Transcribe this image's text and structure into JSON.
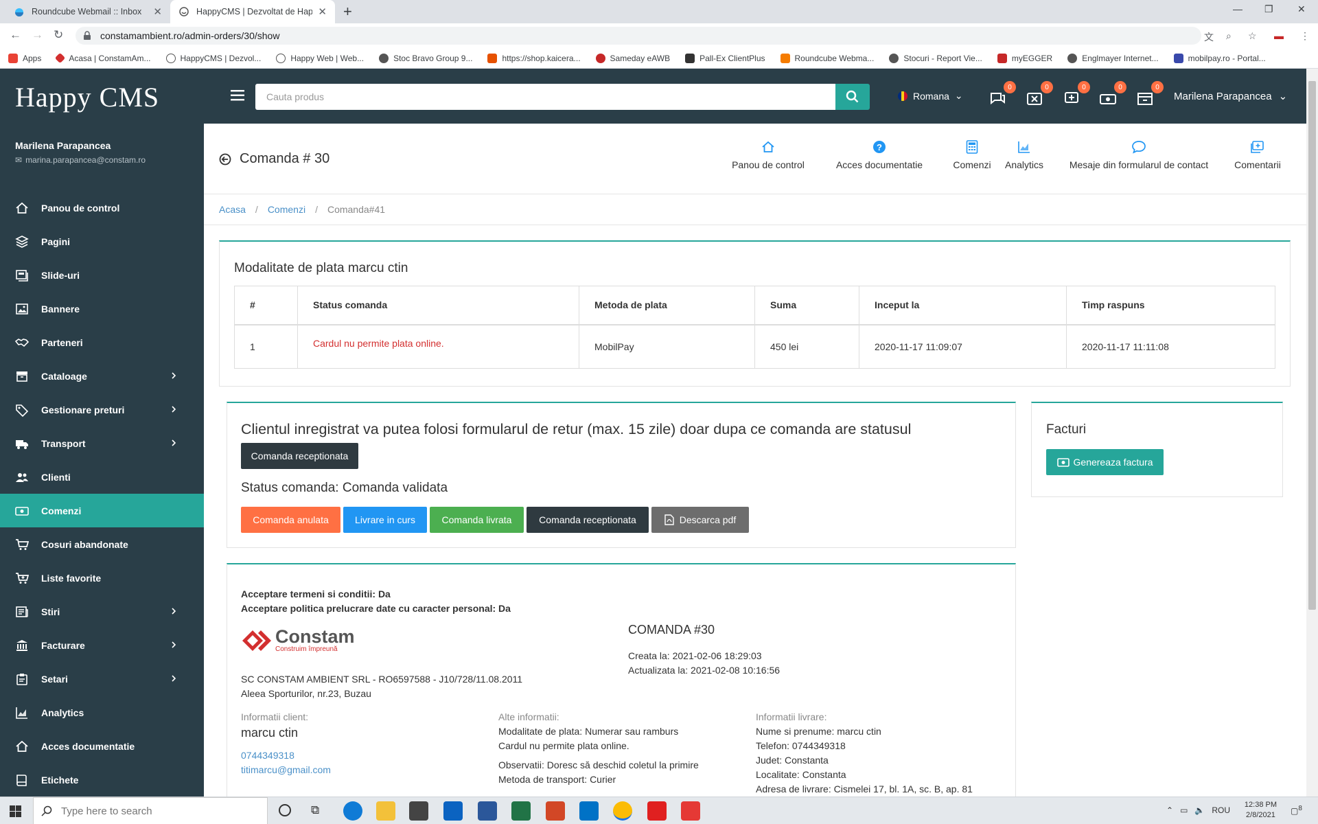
{
  "browser": {
    "tabs": [
      {
        "title": "Roundcube Webmail :: Inbox",
        "active": false
      },
      {
        "title": "HappyCMS | Dezvoltat de Happy",
        "active": true
      }
    ],
    "url": "constamambient.ro/admin-orders/30/show",
    "bookmarks": [
      "Apps",
      "Acasa | ConstamAm...",
      "HappyCMS | Dezvol...",
      "Happy Web | Web...",
      "Stoc Bravo Group 9...",
      "https://shop.kaicera...",
      "Sameday eAWB",
      "Pall-Ex ClientPlus",
      "Roundcube Webma...",
      "Stocuri - Report Vie...",
      "myEGGER",
      "Englmayer Internet...",
      "mobilpay.ro - Portal..."
    ]
  },
  "header": {
    "logo": "Happy CMS",
    "search_placeholder": "Cauta produs",
    "language": "Romana",
    "badges": [
      "0",
      "0",
      "0",
      "0",
      "0"
    ],
    "user": "Marilena Parapancea"
  },
  "sidebar": {
    "user_name": "Marilena Parapancea",
    "user_email": "marina.parapancea@constam.ro",
    "items": [
      {
        "label": "Panou de control",
        "icon": "home-icon",
        "chevron": false
      },
      {
        "label": "Pagini",
        "icon": "layers-icon",
        "chevron": false
      },
      {
        "label": "Slide-uri",
        "icon": "slides-icon",
        "chevron": false
      },
      {
        "label": "Bannere",
        "icon": "image-icon",
        "chevron": false
      },
      {
        "label": "Parteneri",
        "icon": "handshake-icon",
        "chevron": false
      },
      {
        "label": "Cataloage",
        "icon": "archive-icon",
        "chevron": true
      },
      {
        "label": "Gestionare preturi",
        "icon": "tag-icon",
        "chevron": true
      },
      {
        "label": "Transport",
        "icon": "truck-icon",
        "chevron": true
      },
      {
        "label": "Clienti",
        "icon": "users-icon",
        "chevron": false
      },
      {
        "label": "Comenzi",
        "icon": "money-icon",
        "chevron": false,
        "active": true
      },
      {
        "label": "Cosuri abandonate",
        "icon": "cart-icon",
        "chevron": false
      },
      {
        "label": "Liste favorite",
        "icon": "cart-plus-icon",
        "chevron": false
      },
      {
        "label": "Stiri",
        "icon": "news-icon",
        "chevron": true
      },
      {
        "label": "Facturare",
        "icon": "bank-icon",
        "chevron": true
      },
      {
        "label": "Setari",
        "icon": "clipboard-icon",
        "chevron": true
      },
      {
        "label": "Analytics",
        "icon": "chart-icon",
        "chevron": false
      },
      {
        "label": "Acces documentatie",
        "icon": "home-icon",
        "chevron": false
      },
      {
        "label": "Etichete",
        "icon": "book-icon",
        "chevron": false
      }
    ]
  },
  "page": {
    "title": "Comanda # 30",
    "quicknav": [
      "Panou de control",
      "Acces documentatie",
      "Comenzi",
      "Analytics",
      "Mesaje din formularul de contact",
      "Comentarii"
    ],
    "breadcrumb": [
      "Acasa",
      "Comenzi",
      "Comanda#41"
    ]
  },
  "payments": {
    "title": "Modalitate de plata marcu ctin",
    "columns": [
      "#",
      "Status comanda",
      "Metoda de plata",
      "Suma",
      "Inceput la",
      "Timp raspuns"
    ],
    "rows": [
      [
        "1",
        "Cardul nu permite plata online.",
        "MobilPay",
        "450 lei",
        "2020-11-17 11:09:07",
        "2020-11-17 11:11:08"
      ]
    ]
  },
  "status_card": {
    "notice": "Clientul inregistrat va putea folosi formularul de retur (max. 15 zile) doar dupa ce comanda are statusul",
    "notice_button": "Comanda receptionata",
    "status_text": "Status comanda: Comanda validata",
    "buttons": [
      {
        "label": "Comanda anulata",
        "color": "#ff7043"
      },
      {
        "label": "Livrare in curs",
        "color": "#2196f3"
      },
      {
        "label": "Comanda livrata",
        "color": "#4caf50"
      },
      {
        "label": "Comanda receptionata",
        "color": "#2f3a40"
      },
      {
        "label": "Descarca pdf",
        "color": "#6d6d6d"
      }
    ]
  },
  "invoices": {
    "title": "Facturi",
    "button": "Genereaza factura"
  },
  "order": {
    "terms": "Acceptare termeni si conditii: Da",
    "privacy": "Acceptare politica prelucrare date cu caracter personal: Da",
    "brand": "Constam",
    "brand_tagline": "Construim împreună",
    "company": "SC CONSTAM AMBIENT SRL - RO6597588 - J10/728/11.08.2011",
    "address": "Aleea Sporturilor, nr.23, Buzau",
    "order_title": "COMANDA #30",
    "created": "Creata la: 2021-02-06 18:29:03",
    "updated": "Actualizata la: 2021-02-08 10:16:56",
    "client_label": "Informatii client:",
    "client_name": "marcu ctin",
    "client_phone": "0744349318",
    "client_email": "titimarcu@gmail.com",
    "other_label": "Alte informatii:",
    "payment_method": "Modalitate de plata: Numerar sau ramburs",
    "payment_status": "Cardul nu permite plata online.",
    "notes": "Observatii: Doresc să deschid coletul la primire",
    "transport": "Metoda de transport: Curier",
    "delivery_label": "Informatii livrare:",
    "delivery_name": "Nume si prenume: marcu ctin",
    "delivery_phone": "Telefon: 0744349318",
    "delivery_county": "Judet: Constanta",
    "delivery_city": "Localitate: Constanta",
    "delivery_address": "Adresa de livrare: Cismelei 17, bl. 1A, sc. B, ap. 81"
  },
  "taskbar": {
    "search_placeholder": "Type here to search",
    "lang": "ROU",
    "time": "12:38 PM",
    "date": "2/8/2021",
    "notif": "8"
  }
}
